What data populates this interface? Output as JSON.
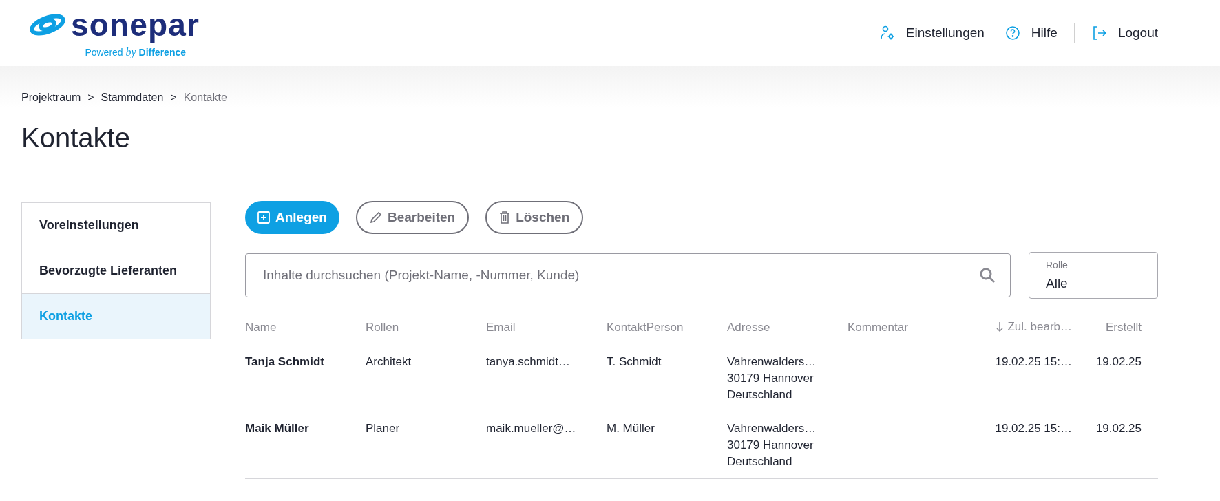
{
  "header": {
    "logo": {
      "wordmark": "sonepar",
      "tagline_prefix": "Powered ",
      "tagline_by": "by",
      "tagline_suffix": " Difference"
    },
    "nav": [
      {
        "kind": "settings",
        "label": "Einstellungen"
      },
      {
        "kind": "help",
        "label": "Hilfe"
      },
      {
        "kind": "logout",
        "label": "Logout"
      }
    ]
  },
  "breadcrumb": [
    {
      "label": "Projektraum",
      "current": false
    },
    {
      "label": "Stammdaten",
      "current": false
    },
    {
      "label": "Kontakte",
      "current": true
    }
  ],
  "breadcrumb_separator": ">",
  "page_title": "Kontakte",
  "sidebar": {
    "items": [
      {
        "label": "Voreinstellungen",
        "selected": false
      },
      {
        "label": "Bevorzugte Lieferanten",
        "selected": false
      },
      {
        "label": "Kontakte",
        "selected": true
      }
    ]
  },
  "toolbar": {
    "buttons": [
      {
        "kind": "add",
        "label": "Anlegen",
        "primary": true
      },
      {
        "kind": "edit",
        "label": "Bearbeiten",
        "primary": false
      },
      {
        "kind": "delete",
        "label": "Löschen",
        "primary": false
      }
    ]
  },
  "search": {
    "placeholder": "Inhalte durchsuchen (Projekt-Name, -Nummer, Kunde)"
  },
  "role_filter": {
    "label": "Rolle",
    "value": "Alle"
  },
  "table": {
    "columns": [
      {
        "label": "Name",
        "sorted": false
      },
      {
        "label": "Rollen",
        "sorted": false
      },
      {
        "label": "Email",
        "sorted": false
      },
      {
        "label": "KontaktPerson",
        "sorted": false
      },
      {
        "label": "Adresse",
        "sorted": false
      },
      {
        "label": "Kommentar",
        "sorted": false
      },
      {
        "label": "Zul. bearb…",
        "sorted": true
      },
      {
        "label": "Erstellt",
        "sorted": false
      }
    ],
    "rows": [
      {
        "cells": [
          [
            "Tanja Schmidt"
          ],
          [
            "Architekt"
          ],
          [
            "tanya.schmidt…"
          ],
          [
            "T. Schmidt"
          ],
          [
            "Vahrenwalders…",
            "30179 Hannover",
            "Deutschland"
          ],
          [],
          [
            "19.02.25 15:…"
          ],
          [
            "19.02.25"
          ]
        ]
      },
      {
        "cells": [
          [
            "Maik Müller"
          ],
          [
            "Planer"
          ],
          [
            "maik.mueller@…"
          ],
          [
            "M. Müller"
          ],
          [
            "Vahrenwalders…",
            "30179 Hannover",
            "Deutschland"
          ],
          [],
          [
            "19.02.25 15:…"
          ],
          [
            "19.02.25"
          ]
        ]
      }
    ]
  }
}
